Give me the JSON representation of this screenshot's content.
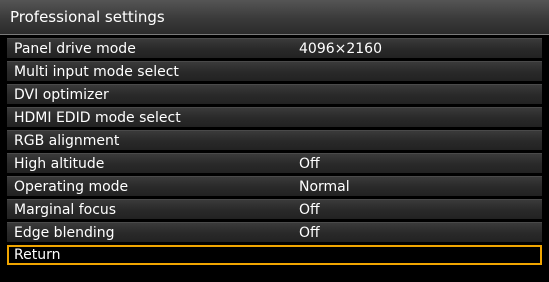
{
  "title": "Professional settings",
  "colors": {
    "background": "#000000",
    "row": "#2e2e2e",
    "selection_highlight": "#f0a500",
    "text": "#ffffff"
  },
  "items": [
    {
      "label": "Panel drive mode",
      "value": "4096×2160"
    },
    {
      "label": "Multi input mode select",
      "value": ""
    },
    {
      "label": "DVI optimizer",
      "value": ""
    },
    {
      "label": "HDMI EDID mode select",
      "value": ""
    },
    {
      "label": "RGB alignment",
      "value": ""
    },
    {
      "label": "High altitude",
      "value": "Off"
    },
    {
      "label": "Operating mode",
      "value": "Normal"
    },
    {
      "label": "Marginal focus",
      "value": "Off"
    },
    {
      "label": "Edge blending",
      "value": "Off"
    },
    {
      "label": "Return",
      "value": ""
    }
  ],
  "selected_item": "Return"
}
